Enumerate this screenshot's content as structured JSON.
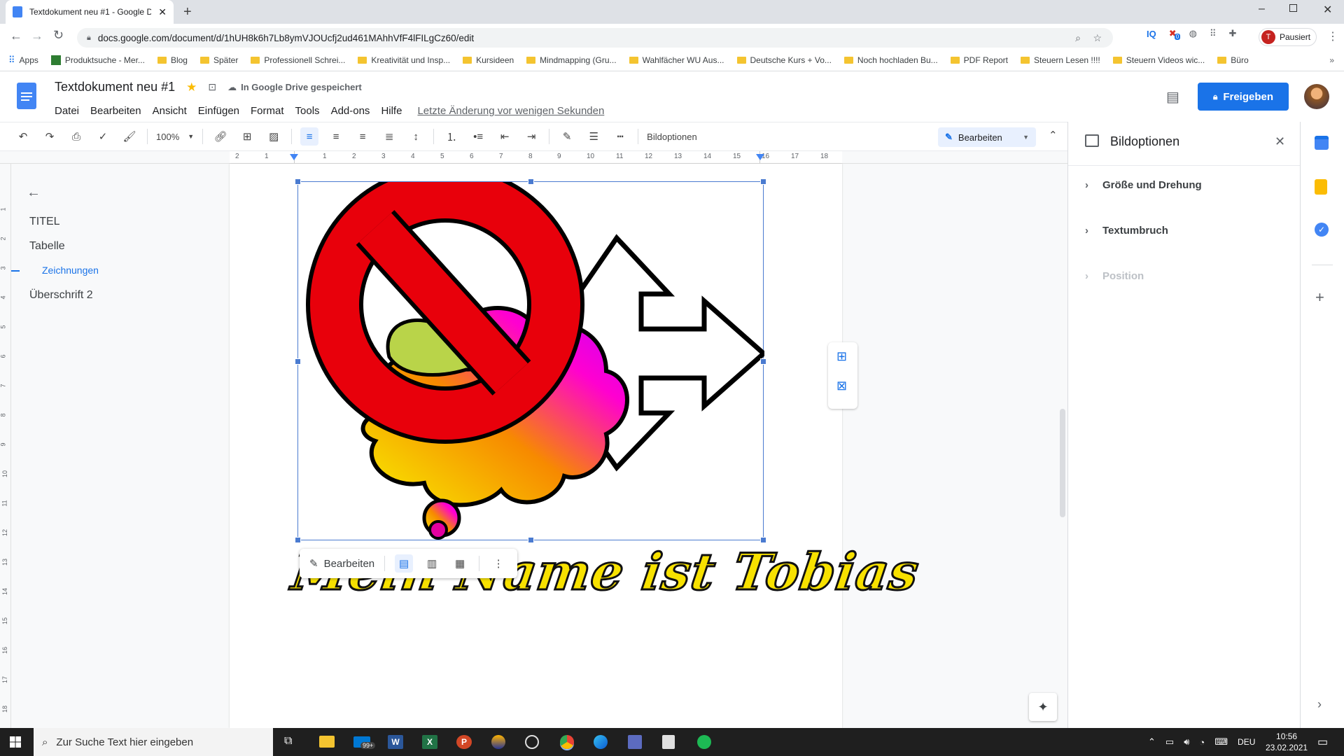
{
  "browser": {
    "tab_title": "Textdokument neu #1 - Google D",
    "url": "docs.google.com/document/d/1hUH8k6h7Lb8ymVJOUcfj2ud461MAhhVfF4lFILgCz60/edit",
    "profile_status": "Pausiert",
    "profile_initial": "T",
    "extension_badge": "0",
    "bookmarks": [
      "Apps",
      "Produktsuche - Mer...",
      "Blog",
      "Später",
      "Professionell Schrei...",
      "Kreativität und Insp...",
      "Kursideen",
      "Mindmapping  (Gru...",
      "Wahlfächer WU Aus...",
      "Deutsche Kurs + Vo...",
      "Noch hochladen Bu...",
      "PDF Report",
      "Steuern Lesen !!!!",
      "Steuern Videos wic...",
      "Büro"
    ]
  },
  "doc": {
    "title": "Textdokument neu #1",
    "save_status": "In Google Drive gespeichert",
    "menu": [
      "Datei",
      "Bearbeiten",
      "Ansicht",
      "Einfügen",
      "Format",
      "Tools",
      "Add-ons",
      "Hilfe"
    ],
    "last_edit": "Letzte Änderung vor wenigen Sekunden",
    "share_label": "Freigeben"
  },
  "toolbar": {
    "zoom": "100%",
    "image_options": "Bildoptionen",
    "mode": "Bearbeiten"
  },
  "ruler": {
    "labels": [
      "2",
      "1",
      "1",
      "2",
      "3",
      "4",
      "5",
      "6",
      "7",
      "8",
      "9",
      "10",
      "11",
      "12",
      "13",
      "14",
      "15",
      "16",
      "17",
      "18"
    ]
  },
  "vruler": {
    "labels": [
      "1",
      "2",
      "3",
      "4",
      "5",
      "6",
      "7",
      "8",
      "9",
      "10",
      "11",
      "12",
      "13",
      "14",
      "15",
      "16",
      "17",
      "18"
    ]
  },
  "outline": {
    "items": [
      {
        "label": "TITEL",
        "level": 1
      },
      {
        "label": "Tabelle",
        "level": 1
      },
      {
        "label": "Zeichnungen",
        "level": 2
      },
      {
        "label": "Überschrift 2",
        "level": 1
      }
    ]
  },
  "canvas": {
    "image_caption": "Mein Name ist Tobias",
    "floating_edit": "Bearbeiten"
  },
  "panel": {
    "title": "Bildoptionen",
    "sections": [
      {
        "label": "Größe und Drehung",
        "enabled": true
      },
      {
        "label": "Textumbruch",
        "enabled": true
      },
      {
        "label": "Position",
        "enabled": false
      }
    ]
  },
  "taskbar": {
    "search_placeholder": "Zur Suche Text hier eingeben",
    "mail_badge": "99+",
    "language": "DEU",
    "time": "10:56",
    "date": "23.02.2021"
  },
  "colors": {
    "accent": "#1a73e8",
    "share_bg": "#1a73e8",
    "no_sign": "#e8000b",
    "caption_yellow": "#f7e100"
  }
}
